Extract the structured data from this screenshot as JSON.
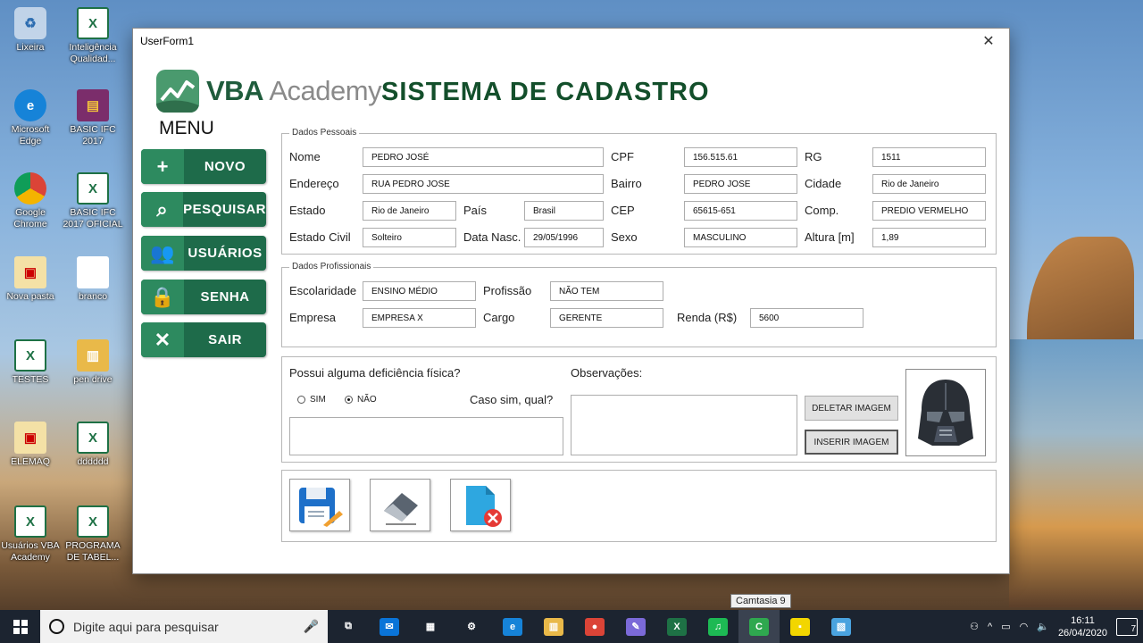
{
  "desktop": {
    "icons": [
      {
        "label": "Lixeira",
        "kind": "bin",
        "glyph": "♻"
      },
      {
        "label": "Inteligência Qualidad...",
        "kind": "excel",
        "glyph": "X"
      },
      {
        "label": "Microsoft Edge",
        "kind": "edge",
        "glyph": "e"
      },
      {
        "label": "BASIC IFC 2017",
        "kind": "rar",
        "glyph": "▤"
      },
      {
        "label": "Google Chrome",
        "kind": "chrome",
        "glyph": ""
      },
      {
        "label": "BASIC IFC 2017 OFICIAL",
        "kind": "excel",
        "glyph": "X"
      },
      {
        "label": "Nova pasta",
        "kind": "pdf",
        "glyph": "▣"
      },
      {
        "label": "branco",
        "kind": "blank",
        "glyph": ""
      },
      {
        "label": "TESTES",
        "kind": "excel",
        "glyph": "X"
      },
      {
        "label": "pen drive",
        "kind": "folder",
        "glyph": "▥"
      },
      {
        "label": "ELEMAQ",
        "kind": "pdf",
        "glyph": "▣"
      },
      {
        "label": "dddddd",
        "kind": "excel",
        "glyph": "X"
      },
      {
        "label": "Usuários VBA Academy",
        "kind": "excel",
        "glyph": "X"
      },
      {
        "label": "PROGRAMA DE TABEL...",
        "kind": "excel",
        "glyph": "X"
      }
    ]
  },
  "window": {
    "title": "UserForm1",
    "close_glyph": "✕",
    "logo_brand": "VBA",
    "logo_word": " Academy",
    "app_title": "SISTEMA DE CADASTRO",
    "menu_title": "MENU"
  },
  "menu": [
    {
      "label": "NOVO",
      "icon": "plus-icon",
      "glyph": "+"
    },
    {
      "label": "PESQUISAR",
      "icon": "search-icon",
      "glyph": "⌕"
    },
    {
      "label": "USUÁRIOS",
      "icon": "users-icon",
      "glyph": "👥"
    },
    {
      "label": "SENHA",
      "icon": "lock-icon",
      "glyph": "🔒"
    },
    {
      "label": "SAIR",
      "icon": "exit-x-icon",
      "glyph": "✕"
    }
  ],
  "personal": {
    "caption": "Dados Pessoais",
    "nome_label": "Nome",
    "nome": "PEDRO JOSÉ",
    "cpf_label": "CPF",
    "cpf": "156.515.61",
    "rg_label": "RG",
    "rg": "1511",
    "endereco_label": "Endereço",
    "endereco": "RUA PEDRO JOSE",
    "bairro_label": "Bairro",
    "bairro": "PEDRO JOSE",
    "cidade_label": "Cidade",
    "cidade": "Rio de Janeiro",
    "estado_label": "Estado",
    "estado": "Rio de Janeiro",
    "pais_label": "País",
    "pais": "Brasil",
    "cep_label": "CEP",
    "cep": "65615-651",
    "comp_label": "Comp.",
    "comp": "PREDIO VERMELHO",
    "civil_label": "Estado Civil",
    "civil": "Solteiro",
    "nasc_label": "Data Nasc.",
    "nasc": "29/05/1996",
    "sexo_label": "Sexo",
    "sexo": "MASCULINO",
    "altura_label": "Altura [m]",
    "altura": "1,89"
  },
  "professional": {
    "caption": "Dados Profissionais",
    "escolaridade_label": "Escolaridade",
    "escolaridade": "ENSINO MÉDIO",
    "profissao_label": "Profissão",
    "profissao": "NÃO TEM",
    "empresa_label": "Empresa",
    "empresa": "EMPRESA X",
    "cargo_label": "Cargo",
    "cargo": "GERENTE",
    "renda_label": "Renda (R$)",
    "renda": "5600"
  },
  "extra": {
    "deficiencia_question": "Possui alguma deficiência física?",
    "sim_label": "SIM",
    "nao_label": "NÃO",
    "selected": "NÃO",
    "qual_label": "Caso sim, qual?",
    "obs_label": "Observações:",
    "delete_image": "DELETAR IMAGEM",
    "insert_image": "INSERIR IMAGEM"
  },
  "tooltip": "Camtasia 9",
  "taskbar": {
    "search_placeholder": "Digite aqui para pesquisar",
    "time": "16:11",
    "date": "26/04/2020",
    "notifications": "7",
    "apps": [
      {
        "name": "task-view",
        "glyph": "⧉",
        "color": "#1c2430"
      },
      {
        "name": "mail",
        "glyph": "✉",
        "color": "#0a74d8"
      },
      {
        "name": "store",
        "glyph": "▦",
        "color": "#1c2430"
      },
      {
        "name": "settings",
        "glyph": "⚙",
        "color": "#1c2430"
      },
      {
        "name": "edge",
        "glyph": "e",
        "color": "#1683d8"
      },
      {
        "name": "file-explorer",
        "glyph": "▥",
        "color": "#e9b949"
      },
      {
        "name": "chrome",
        "glyph": "●",
        "color": "#db4437"
      },
      {
        "name": "paint",
        "glyph": "✎",
        "color": "#7b6ad8"
      },
      {
        "name": "excel",
        "glyph": "X",
        "color": "#1e7145"
      },
      {
        "name": "spotify",
        "glyph": "♫",
        "color": "#1db954"
      },
      {
        "name": "camtasia",
        "glyph": "C",
        "color": "#2fa84f"
      },
      {
        "name": "sticky-notes",
        "glyph": "▪",
        "color": "#f2d600"
      },
      {
        "name": "notepad",
        "glyph": "▧",
        "color": "#4aa3df"
      }
    ]
  }
}
